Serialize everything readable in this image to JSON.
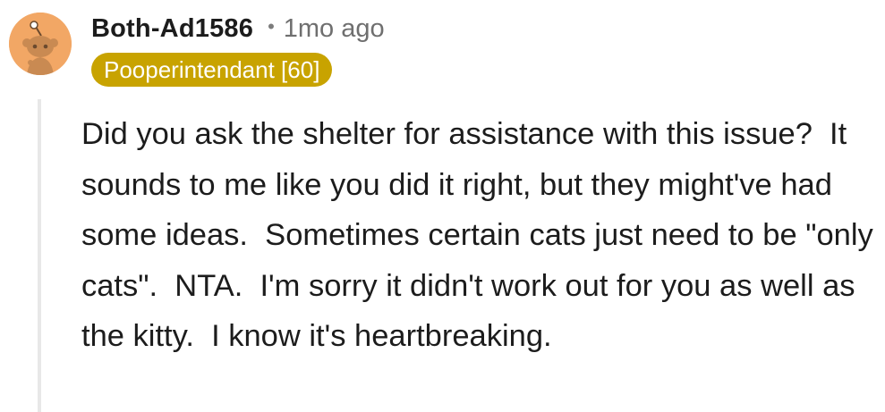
{
  "comment": {
    "username": "Both-Ad1586",
    "separator": "•",
    "timestamp": "1mo ago",
    "flair": "Pooperintendant [60]",
    "body": "Did you ask the shelter for assistance with this issue?  It sounds to me like you did it right, but they might've had some ideas.  Sometimes certain cats just need to be \"only cats\".  NTA.  I'm sorry it didn't work out for you as well as the kitty.  I know it's heartbreaking."
  },
  "colors": {
    "avatar_bg": "#f2a765",
    "flair_bg": "#c8a300",
    "username": "#1c1c1c",
    "timestamp": "#6f6f6f",
    "thread_line": "#e8e8e8"
  },
  "icons": {
    "avatar": "snoo-avatar-icon"
  }
}
